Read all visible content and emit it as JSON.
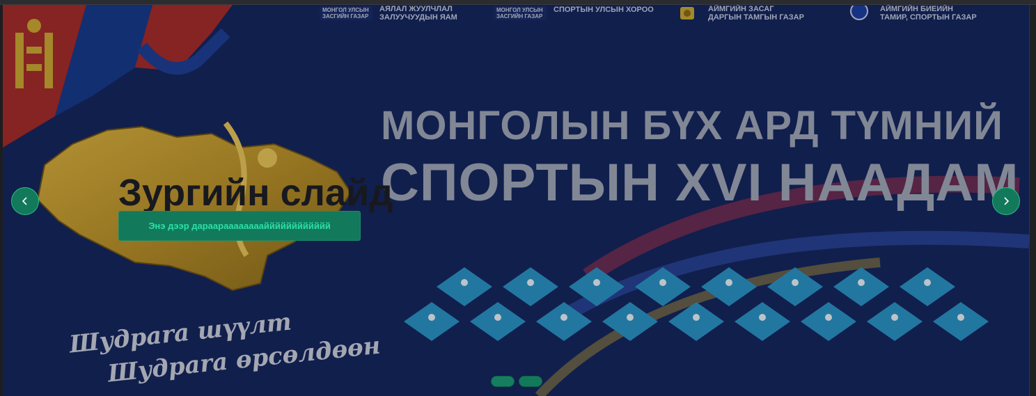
{
  "logos": [
    {
      "org_line1": "МОНГОЛ УЛСЫН",
      "org_line2": "ЗАСГИЙН ГАЗАР",
      "label_line1": "АЯЛАЛ ЖУУЛЧЛАЛ",
      "label_line2": "ЗАЛУУЧУУДЫН ЯАМ"
    },
    {
      "org_line1": "МОНГОЛ УЛСЫН",
      "org_line2": "ЗАСГИЙН ГАЗАР",
      "label_line1": "СПОРТЫН УЛСЫН ХОРОО"
    },
    {
      "label_line1": "АЙМГИЙН ЗАСАГ",
      "label_line2": "ДАРГЫН ТАМГЫН ГАЗАР"
    },
    {
      "label_line1": "АЙМГИЙН БИЕИЙН",
      "label_line2": "ТАМИР, СПОРТЫН ГАЗАР"
    }
  ],
  "banner": {
    "headline_line1": "МОНГОЛЫН  БҮХ АРД ТҮМНИЙ",
    "headline_line2": "СПОРТЫН  XVI  НААДАМ",
    "slogan_line1": "Шудраrа шүүлт",
    "slogan_line2": "Шудраrа өрсөлдөөн"
  },
  "caption": {
    "title": "Зургийн слайд",
    "button_label": "Энэ дээр дараараааааааайййййййййййй"
  },
  "nav": {
    "prev_icon": "chevron-left-icon",
    "next_icon": "chevron-right-icon"
  },
  "colors": {
    "slide_bg": "#15275f",
    "accent": "#13795b",
    "accent_text": "#2ae0a8"
  },
  "slides_count": 2
}
